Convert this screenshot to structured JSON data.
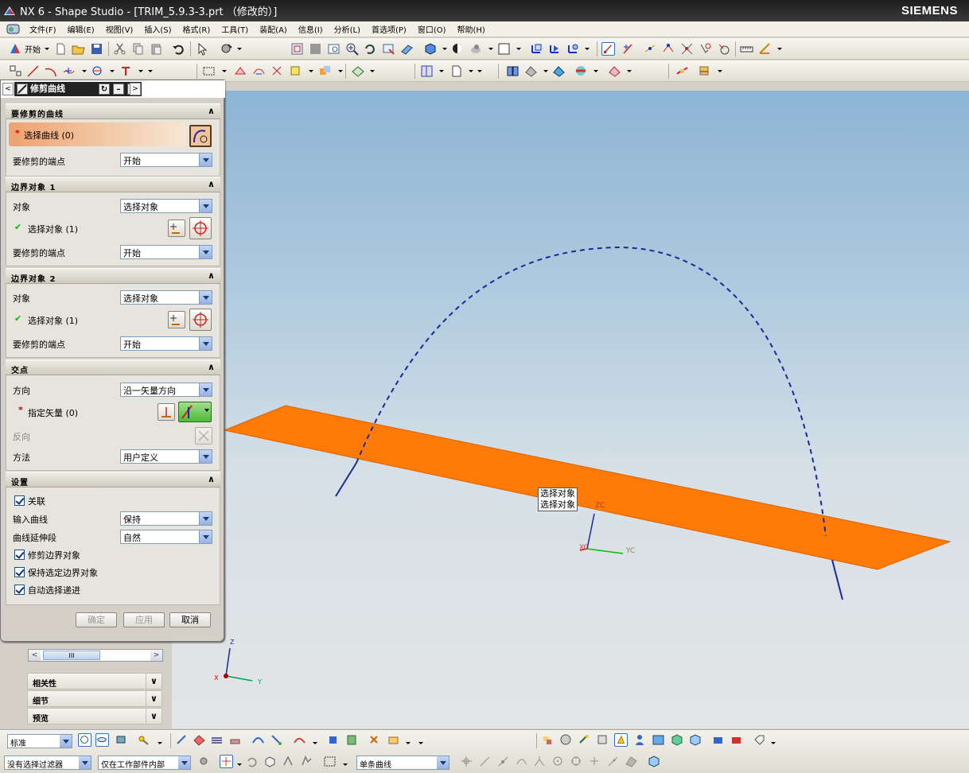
{
  "window": {
    "title": "NX 6 - Shape Studio - [TRIM_5.9.3-3.prt （修改的）]",
    "brand": "SIEMENS"
  },
  "menu": [
    "文件(F)",
    "编辑(E)",
    "视图(V)",
    "插入(S)",
    "格式(R)",
    "工具(T)",
    "装配(A)",
    "信息(I)",
    "分析(L)",
    "首选项(P)",
    "窗口(O)",
    "帮助(H)"
  ],
  "toolbar": {
    "start_label": "开始"
  },
  "dialog": {
    "title": "修剪曲线",
    "sections": {
      "curve": {
        "header": "要修剪的曲线",
        "select_curve": "选择曲线 (0)",
        "end_label": "要修剪的端点",
        "end_value": "开始"
      },
      "bound1": {
        "header": "边界对象 1",
        "object_label": "对象",
        "object_value": "选择对象",
        "select_label": "选择对象 (1)",
        "end_label": "要修剪的端点",
        "end_value": "开始"
      },
      "bound2": {
        "header": "边界对象 2",
        "object_label": "对象",
        "object_value": "选择对象",
        "select_label": "选择对象 (1)",
        "end_label": "要修剪的端点",
        "end_value": "开始"
      },
      "intersection": {
        "header": "交点",
        "direction_label": "方向",
        "direction_value": "沿一矢量方向",
        "vector_label": "指定矢量 (0)",
        "reverse_label": "反向",
        "method_label": "方法",
        "method_value": "用户定义"
      },
      "settings": {
        "header": "设置",
        "associative": "关联",
        "input_curve_label": "输入曲线",
        "input_curve_value": "保持",
        "extension_label": "曲线延伸段",
        "extension_value": "自然",
        "trim_boundary": "修剪边界对象",
        "keep_selected": "保持选定边界对象",
        "auto_select": "自动选择递进"
      }
    },
    "buttons": {
      "ok": "确定",
      "apply": "应用",
      "cancel": "取消"
    }
  },
  "resource": {
    "panels": [
      "相关性",
      "细节",
      "预览"
    ],
    "scroll_mark": "III"
  },
  "viewport": {
    "tooltip_lines": [
      "选择对象",
      "选择对象"
    ],
    "wcs": {
      "zc": "ZC",
      "yc": "YC",
      "xc": "XC"
    },
    "abs": {
      "z": "Z",
      "y": "Y",
      "x": "X"
    },
    "colors": {
      "plane": "#ff7a06",
      "curve": "#1a2a9c"
    }
  },
  "statusbar": {
    "combo1": "标准",
    "filter": "没有选择过滤器",
    "scope": "仅在工作部件内部",
    "curve_rule": "单条曲线"
  }
}
